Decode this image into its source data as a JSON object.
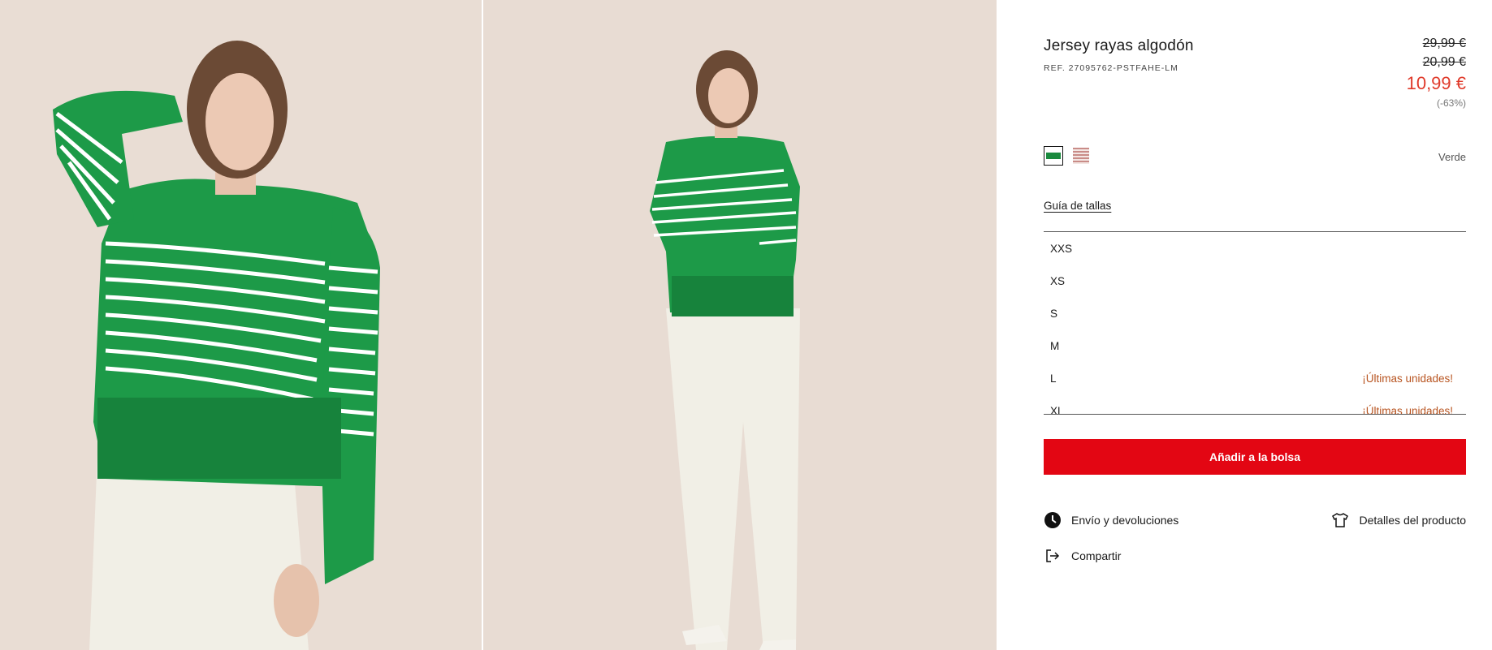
{
  "product": {
    "title": "Jersey rayas algodón",
    "ref": "REF. 27095762-PSTFAHE-LM",
    "price_original": "29,99 €",
    "price_previous": "20,99 €",
    "price_current": "10,99 €",
    "discount": "(-63%)"
  },
  "colors": {
    "selected_name": "Verde",
    "swatches": [
      {
        "name": "green-stripes",
        "color": "#1a8a3e"
      },
      {
        "name": "pink-stripes",
        "color": "#c98c88"
      }
    ]
  },
  "size_guide_label": "Guía de tallas",
  "sizes": [
    {
      "label": "XXS",
      "note": ""
    },
    {
      "label": "XS",
      "note": ""
    },
    {
      "label": "S",
      "note": ""
    },
    {
      "label": "M",
      "note": ""
    },
    {
      "label": "L",
      "note": "¡Últimas unidades!"
    },
    {
      "label": "XL",
      "note": "¡Últimas unidades!"
    }
  ],
  "add_to_bag_label": "Añadir a la bolsa",
  "links": {
    "shipping": "Envío y devoluciones",
    "details": "Detalles del producto",
    "share": "Compartir"
  },
  "theme": {
    "accent": "#e30613",
    "sale": "#e03a2a",
    "stock": "#b85420"
  }
}
